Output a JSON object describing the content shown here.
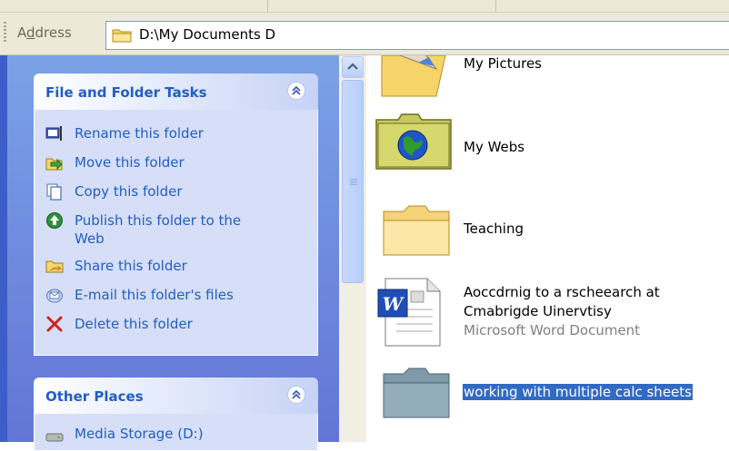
{
  "address_bar": {
    "label_prefix": "A",
    "label_underlined": "d",
    "label_rest": "dress",
    "path": "D:\\My Documents D"
  },
  "tasks_pane": {
    "file_folder_tasks": {
      "title": "File and Folder Tasks",
      "items": [
        {
          "label": "Rename this folder",
          "icon": "rename-icon"
        },
        {
          "label": "Move this folder",
          "icon": "move-icon"
        },
        {
          "label": "Copy this folder",
          "icon": "copy-icon"
        },
        {
          "label": "Publish this folder to the Web",
          "icon": "publish-icon"
        },
        {
          "label": "Share this folder",
          "icon": "share-icon"
        },
        {
          "label": "E-mail this folder's files",
          "icon": "email-icon"
        },
        {
          "label": "Delete this folder",
          "icon": "delete-icon"
        }
      ]
    },
    "other_places": {
      "title": "Other Places",
      "items": [
        {
          "label": "Media Storage (D:)",
          "icon": "drive-icon"
        }
      ]
    }
  },
  "files": [
    {
      "name": "My Pictures",
      "icon": "pictures-folder-icon"
    },
    {
      "name": "My Webs",
      "icon": "webs-folder-icon"
    },
    {
      "name": "Teaching",
      "icon": "folder-icon"
    },
    {
      "name": "Aoccdrnig to a rscheearch at",
      "name_line2": "Cmabrigde Uinervtisy",
      "type": "Microsoft Word Document",
      "icon": "word-document-icon"
    },
    {
      "name": "working with multiple calc sheets",
      "icon": "folder-icon",
      "selected": true
    }
  ],
  "colors": {
    "pane_gradient_top": "#7ba2e7",
    "pane_gradient_bottom": "#6375d6",
    "link_blue": "#215dc6",
    "selection": "#316ac5"
  }
}
